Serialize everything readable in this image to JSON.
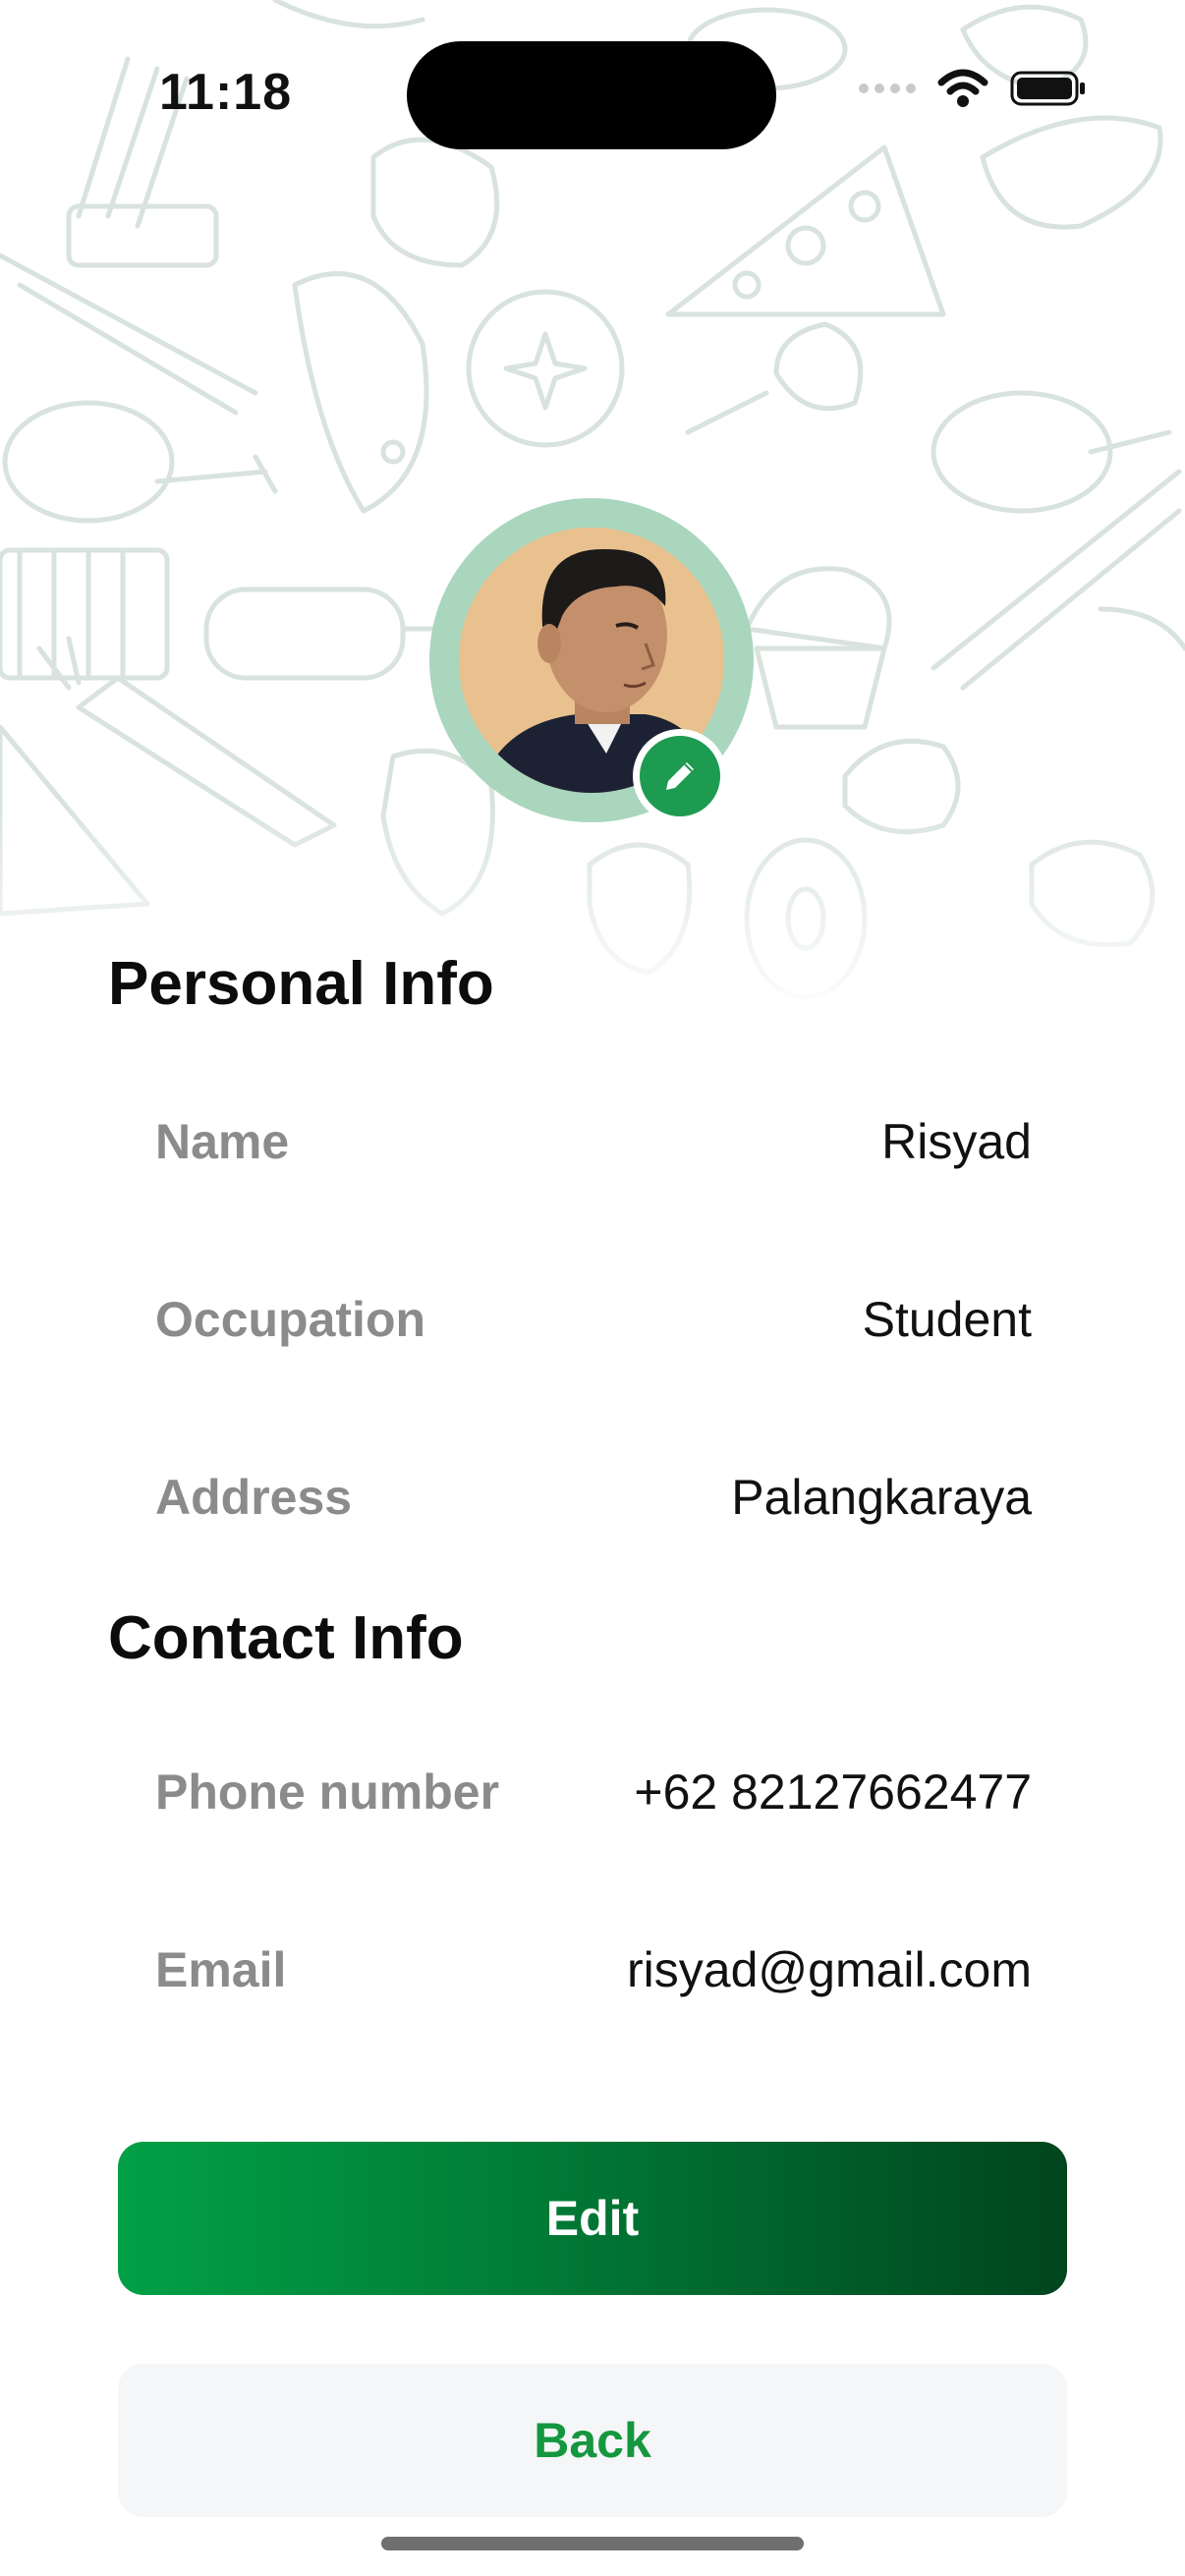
{
  "status_bar": {
    "time": "11:18"
  },
  "profile": {
    "avatar_alt": "profile photo",
    "edit_photo_icon": "pencil-icon"
  },
  "personal_info": {
    "title": "Personal Info",
    "fields": [
      {
        "label": "Name",
        "value": "Risyad"
      },
      {
        "label": "Occupation",
        "value": "Student"
      },
      {
        "label": "Address",
        "value": "Palangkaraya"
      }
    ]
  },
  "contact_info": {
    "title": "Contact Info",
    "fields": [
      {
        "label": "Phone number",
        "value": "+62 82127662477"
      },
      {
        "label": "Email",
        "value": "risyad@gmail.com"
      }
    ]
  },
  "buttons": {
    "edit_label": "Edit",
    "back_label": "Back"
  },
  "colors": {
    "accent": "#1d9b50",
    "back_text": "#14973f",
    "avatar_ring": "#a9d6bd"
  }
}
